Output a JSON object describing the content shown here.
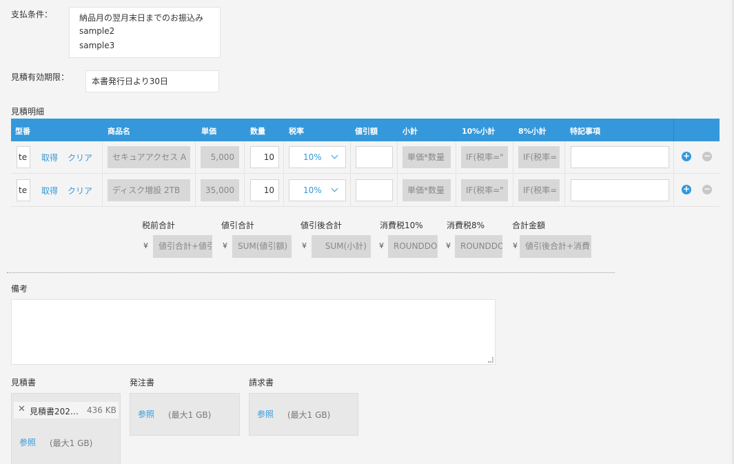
{
  "payment": {
    "label": "支払条件：",
    "options": [
      "納品月の翌月末日までのお振込み",
      "sample2",
      "sample3"
    ]
  },
  "validity": {
    "label": "見積有効期限：",
    "value": "本書発行日より30日"
  },
  "details": {
    "label": "見積明細",
    "headers": [
      "型番",
      "商品名",
      "単価",
      "数量",
      "税率",
      "値引額",
      "小計",
      "10%小計",
      "8%小計",
      "特記事項"
    ],
    "get_label": "取得",
    "clear_label": "クリア",
    "add_icon": "plus-circle-icon",
    "remove_icon": "minus-circle-icon",
    "rows": [
      {
        "model": "te",
        "product": "セキュアアクセス A",
        "unit_price": "5,000",
        "qty": "10",
        "tax": "10%",
        "discount": "",
        "subtotal": "単価*数量",
        "sub10": "IF(税率=\"",
        "sub8": "IF(税率=",
        "notes": ""
      },
      {
        "model": "te",
        "product": "ディスク増設 2TB",
        "unit_price": "35,000",
        "qty": "10",
        "tax": "10%",
        "discount": "",
        "subtotal": "単価*数量",
        "sub10": "IF(税率=\"",
        "sub8": "IF(税率=",
        "notes": ""
      }
    ]
  },
  "totals": {
    "currency": "¥",
    "items": [
      {
        "label": "税前合計",
        "value": "値引合計+値引"
      },
      {
        "label": "値引合計",
        "value": "SUM(値引額)"
      },
      {
        "label": "値引後合計",
        "value": "SUM(小計)"
      },
      {
        "label": "消費税10%",
        "value": "ROUNDDOWN"
      },
      {
        "label": "消費税8%",
        "value": "ROUNDDOWN"
      },
      {
        "label": "合計金額",
        "value": "値引後合計+消費"
      }
    ]
  },
  "remarks": {
    "label": "備考",
    "value": ""
  },
  "attachments": {
    "browse_label": "参照",
    "max_label": "(最大1 GB)",
    "quote": {
      "label": "見積書",
      "file_name": "見積書202…",
      "file_size": "436 KB"
    },
    "order": {
      "label": "発注書"
    },
    "invoice": {
      "label": "請求書"
    }
  },
  "colors": {
    "accent": "#3498db",
    "readonly": "#d8d8d8",
    "background": "#f4f4f4"
  }
}
